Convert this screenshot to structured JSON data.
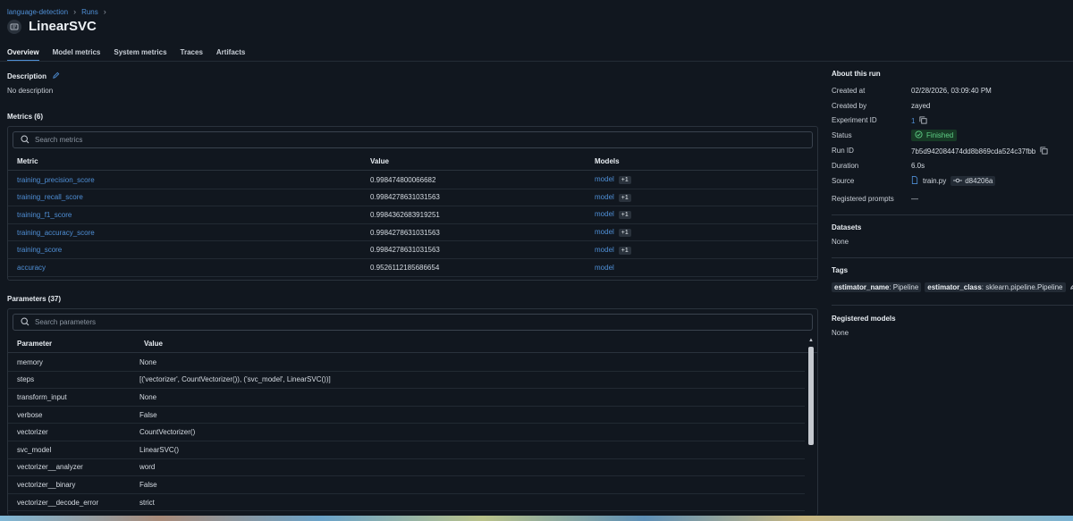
{
  "breadcrumb": {
    "experiment": "language-detection",
    "runs": "Runs"
  },
  "run": {
    "title": "LinearSVC"
  },
  "tabs": [
    {
      "label": "Overview",
      "active": true
    },
    {
      "label": "Model metrics"
    },
    {
      "label": "System metrics"
    },
    {
      "label": "Traces"
    },
    {
      "label": "Artifacts"
    }
  ],
  "description": {
    "title": "Description",
    "text": "No description"
  },
  "metrics": {
    "title": "Metrics (6)",
    "search_placeholder": "Search metrics",
    "headers": {
      "metric": "Metric",
      "value": "Value",
      "models": "Models"
    },
    "rows": [
      {
        "name": "training_precision_score",
        "value": "0.998474800066682",
        "model": "model",
        "extra": "+1"
      },
      {
        "name": "training_recall_score",
        "value": "0.9984278631031563",
        "model": "model",
        "extra": "+1"
      },
      {
        "name": "training_f1_score",
        "value": "0.9984362683919251",
        "model": "model",
        "extra": "+1"
      },
      {
        "name": "training_accuracy_score",
        "value": "0.9984278631031563",
        "model": "model",
        "extra": "+1"
      },
      {
        "name": "training_score",
        "value": "0.9984278631031563",
        "model": "model",
        "extra": "+1"
      },
      {
        "name": "accuracy",
        "value": "0.9526112185686654",
        "model": "model",
        "extra": ""
      }
    ]
  },
  "parameters": {
    "title": "Parameters (37)",
    "search_placeholder": "Search parameters",
    "headers": {
      "parameter": "Parameter",
      "value": "Value"
    },
    "rows": [
      {
        "name": "memory",
        "value": "None"
      },
      {
        "name": "steps",
        "value": "[('vectorizer', CountVectorizer()), ('svc_model', LinearSVC())]"
      },
      {
        "name": "transform_input",
        "value": "None"
      },
      {
        "name": "verbose",
        "value": "False"
      },
      {
        "name": "vectorizer",
        "value": "CountVectorizer()"
      },
      {
        "name": "svc_model",
        "value": "LinearSVC()"
      },
      {
        "name": "vectorizer__analyzer",
        "value": "word"
      },
      {
        "name": "vectorizer__binary",
        "value": "False"
      },
      {
        "name": "vectorizer__decode_error",
        "value": "strict"
      }
    ]
  },
  "about": {
    "title": "About this run",
    "created_at_label": "Created at",
    "created_at": "02/28/2026, 03:09:40 PM",
    "created_by_label": "Created by",
    "created_by": "zayed",
    "experiment_id_label": "Experiment ID",
    "experiment_id": "1",
    "status_label": "Status",
    "status": "Finished",
    "run_id_label": "Run ID",
    "run_id": "7b5d942084474dd8b869cda524c37fbb",
    "duration_label": "Duration",
    "duration": "6.0s",
    "source_label": "Source",
    "source_file": "train.py",
    "source_commit": "d84206a",
    "registered_prompts_label": "Registered prompts",
    "registered_prompts": "—"
  },
  "datasets": {
    "title": "Datasets",
    "value": "None"
  },
  "tags": {
    "title": "Tags",
    "items": [
      {
        "key": "estimator_name",
        "value": ": Pipeline"
      },
      {
        "key": "estimator_class",
        "value": ": sklearn.pipeline.Pipeline"
      }
    ]
  },
  "registered_models": {
    "title": "Registered models",
    "value": "None"
  },
  "colors": {
    "background": "#11171f",
    "link": "#4f8fd6",
    "status_green": "#5fcf86"
  }
}
